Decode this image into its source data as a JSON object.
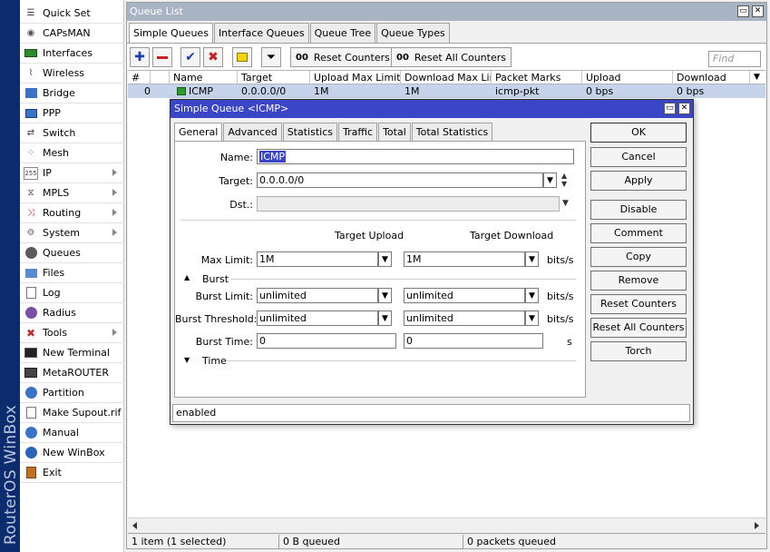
{
  "sidebar": {
    "brand": "RouterOS WinBox",
    "items": [
      {
        "label": "Quick Set",
        "icon": "quick-set-icon",
        "arrow": false
      },
      {
        "label": "CAPsMAN",
        "icon": "capsman-icon",
        "arrow": false
      },
      {
        "label": "Interfaces",
        "icon": "interfaces-icon",
        "arrow": false
      },
      {
        "label": "Wireless",
        "icon": "wireless-icon",
        "arrow": false
      },
      {
        "label": "Bridge",
        "icon": "bridge-icon",
        "arrow": false
      },
      {
        "label": "PPP",
        "icon": "ppp-icon",
        "arrow": false
      },
      {
        "label": "Switch",
        "icon": "switch-icon",
        "arrow": false
      },
      {
        "label": "Mesh",
        "icon": "mesh-icon",
        "arrow": false
      },
      {
        "label": "IP",
        "icon": "ip-icon",
        "arrow": true
      },
      {
        "label": "MPLS",
        "icon": "mpls-icon",
        "arrow": true
      },
      {
        "label": "Routing",
        "icon": "routing-icon",
        "arrow": true
      },
      {
        "label": "System",
        "icon": "system-icon",
        "arrow": true
      },
      {
        "label": "Queues",
        "icon": "queues-icon",
        "arrow": false
      },
      {
        "label": "Files",
        "icon": "files-icon",
        "arrow": false
      },
      {
        "label": "Log",
        "icon": "log-icon",
        "arrow": false
      },
      {
        "label": "Radius",
        "icon": "radius-icon",
        "arrow": false
      },
      {
        "label": "Tools",
        "icon": "tools-icon",
        "arrow": true
      },
      {
        "label": "New Terminal",
        "icon": "terminal-icon",
        "arrow": false
      },
      {
        "label": "MetaROUTER",
        "icon": "metarouter-icon",
        "arrow": false
      },
      {
        "label": "Partition",
        "icon": "partition-icon",
        "arrow": false
      },
      {
        "label": "Make Supout.rif",
        "icon": "supout-icon",
        "arrow": false
      },
      {
        "label": "Manual",
        "icon": "manual-icon",
        "arrow": false
      },
      {
        "label": "New WinBox",
        "icon": "winbox-icon",
        "arrow": false
      },
      {
        "label": "Exit",
        "icon": "exit-icon",
        "arrow": false
      }
    ]
  },
  "queue_window": {
    "title": "Queue List",
    "tabs": [
      "Simple Queues",
      "Interface Queues",
      "Queue Tree",
      "Queue Types"
    ],
    "active_tab": "Simple Queues",
    "toolbar": {
      "reset_counters": "Reset Counters",
      "reset_all_counters": "Reset All Counters",
      "find_placeholder": "Find"
    },
    "columns": [
      "#",
      "Name",
      "Target",
      "Upload Max Limit",
      "Download Max Limit",
      "Packet Marks",
      "Upload",
      "Download"
    ],
    "rows": [
      {
        "num": "0",
        "name": "ICMP",
        "target": "0.0.0.0/0",
        "upload_max": "1M",
        "download_max": "1M",
        "packet_marks": "icmp-pkt",
        "upload": "0 bps",
        "download": "0 bps"
      }
    ],
    "status": {
      "items": "1 item (1 selected)",
      "queued": "0 B queued",
      "packets": "0 packets queued"
    }
  },
  "dialog": {
    "title": "Simple Queue <ICMP>",
    "tabs": [
      "General",
      "Advanced",
      "Statistics",
      "Traffic",
      "Total",
      "Total Statistics"
    ],
    "active_tab": "General",
    "fields": {
      "name_label": "Name:",
      "name_value": "ICMP",
      "target_label": "Target:",
      "target_value": "0.0.0.0/0",
      "dst_label": "Dst.:",
      "dst_value": "",
      "target_upload_header": "Target Upload",
      "target_download_header": "Target Download",
      "max_limit_label": "Max Limit:",
      "max_limit_upload": "1M",
      "max_limit_download": "1M",
      "burst_section": "Burst",
      "burst_limit_label": "Burst Limit:",
      "burst_limit_upload": "unlimited",
      "burst_limit_download": "unlimited",
      "burst_threshold_label": "Burst Threshold:",
      "burst_threshold_upload": "unlimited",
      "burst_threshold_download": "unlimited",
      "burst_time_label": "Burst Time:",
      "burst_time_upload": "0",
      "burst_time_download": "0",
      "time_section": "Time",
      "unit_bits": "bits/s",
      "unit_s": "s"
    },
    "buttons": {
      "ok": "OK",
      "cancel": "Cancel",
      "apply": "Apply",
      "disable": "Disable",
      "comment": "Comment",
      "copy": "Copy",
      "remove": "Remove",
      "reset_counters": "Reset Counters",
      "reset_all_counters": "Reset All Counters",
      "torch": "Torch"
    },
    "status": "enabled"
  },
  "colors": {
    "sidebar_brand_bg": "#0d2c6e",
    "dialog_title_bg": "#3a46c6",
    "selected_row": "#c6d3ea",
    "inactive_title_bg": "#a8b4c4"
  }
}
